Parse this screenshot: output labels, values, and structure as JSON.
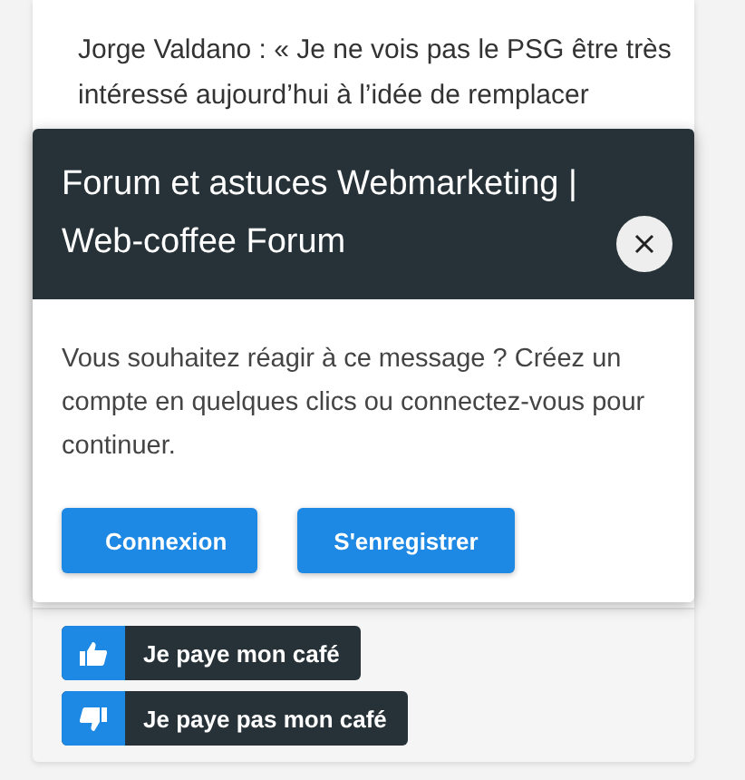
{
  "article": {
    "text": "Jorge Valdano : « Je ne vois pas le PSG être très intéressé aujourd’hui à l’idée de remplacer"
  },
  "modal": {
    "title": "Forum et astuces Webmarketing | Web-coffee Forum",
    "message": "Vous souhaitez réagir à ce message ? Créez un compte en quelques clics ou connectez-vous pour continuer.",
    "buttons": [
      "Connexion",
      "S'enregistrer"
    ]
  },
  "votes": [
    {
      "kind": "like",
      "label": "Je paye mon café"
    },
    {
      "kind": "dislike",
      "label": "Je paye pas mon café"
    }
  ]
}
